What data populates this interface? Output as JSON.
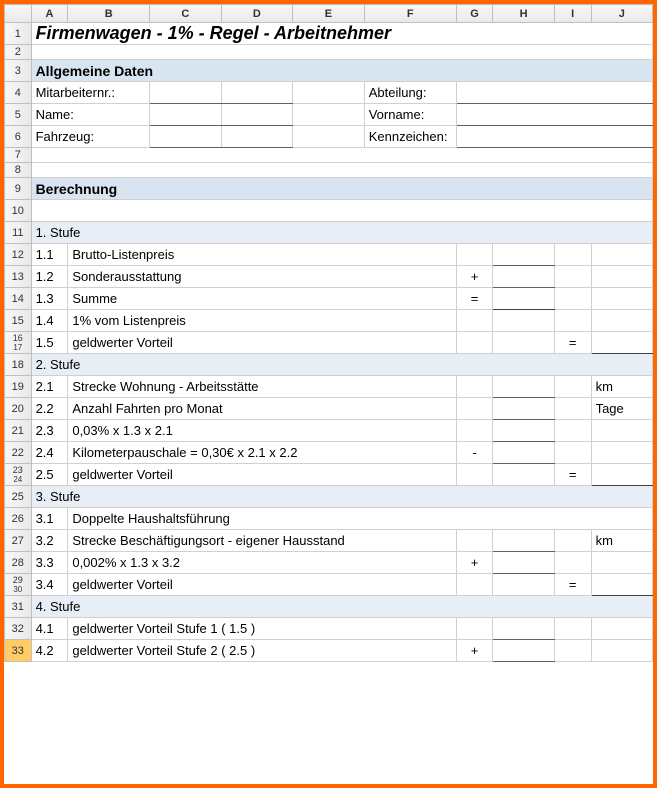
{
  "columns": [
    "",
    "A",
    "B",
    "C",
    "D",
    "E",
    "F",
    "G",
    "H",
    "I",
    "J"
  ],
  "rows": [
    "1",
    "2",
    "3",
    "4",
    "5",
    "6",
    "7",
    "8",
    "9",
    "10",
    "11",
    "12",
    "13",
    "14",
    "15",
    "16",
    "17",
    "18",
    "19",
    "20",
    "21",
    "22",
    "23",
    "24",
    "25",
    "26",
    "27",
    "28",
    "29",
    "30",
    "31",
    "32",
    "33"
  ],
  "row33_selected": true,
  "title": "Firmenwagen - 1% - Regel - Arbeitnehmer",
  "section_general": "Allgemeine Daten",
  "general": {
    "mitarbeiternr": "Mitarbeiternr.:",
    "abteilung": "Abteilung:",
    "name": "Name:",
    "vorname": "Vorname:",
    "fahrzeug": "Fahrzeug:",
    "kennzeichen": "Kennzeichen:"
  },
  "section_calc": "Berechnung",
  "stufe1": {
    "header": "1. Stufe",
    "r11": "1.1",
    "t11": "Brutto-Listenpreis",
    "r12": "1.2",
    "t12": "Sonderausstattung",
    "r13": "1.3",
    "t13": "Summe",
    "r14": "1.4",
    "t14": "1% vom Listenpreis",
    "r15": "1.5",
    "t15": "geldwerter Vorteil",
    "op_plus": "+",
    "op_eq": "="
  },
  "stufe2": {
    "header": "2. Stufe",
    "r21": "2.1",
    "t21": "Strecke Wohnung - Arbeitsstätte",
    "u21": "km",
    "r22": "2.2",
    "t22": "Anzahl Fahrten pro Monat",
    "u22": "Tage",
    "r23": "2.3",
    "t23": "0,03% x 1.3 x 2.1",
    "r24": "2.4",
    "t24": "Kilometerpauschale = 0,30€ x 2.1 x 2.2",
    "r25": "2.5",
    "t25": "geldwerter Vorteil",
    "op_minus": "-",
    "op_eq": "="
  },
  "stufe3": {
    "header": "3. Stufe",
    "r31": "3.1",
    "t31": "Doppelte Haushaltsführung",
    "r32": "3.2",
    "t32": "Strecke Beschäftigungsort - eigener Hausstand",
    "u32": "km",
    "r33": "3.3",
    "t33": "0,002% x 1.3 x 3.2",
    "r34": "3.4",
    "t34": "geldwerter Vorteil",
    "op_plus": "+",
    "op_eq": "="
  },
  "stufe4": {
    "header": "4. Stufe",
    "r41": "4.1",
    "t41": "geldwerter Vorteil Stufe 1 ( 1.5 )",
    "r42": "4.2",
    "t42": "geldwerter Vorteil Stufe 2 ( 2.5 )",
    "op_plus": "+"
  }
}
